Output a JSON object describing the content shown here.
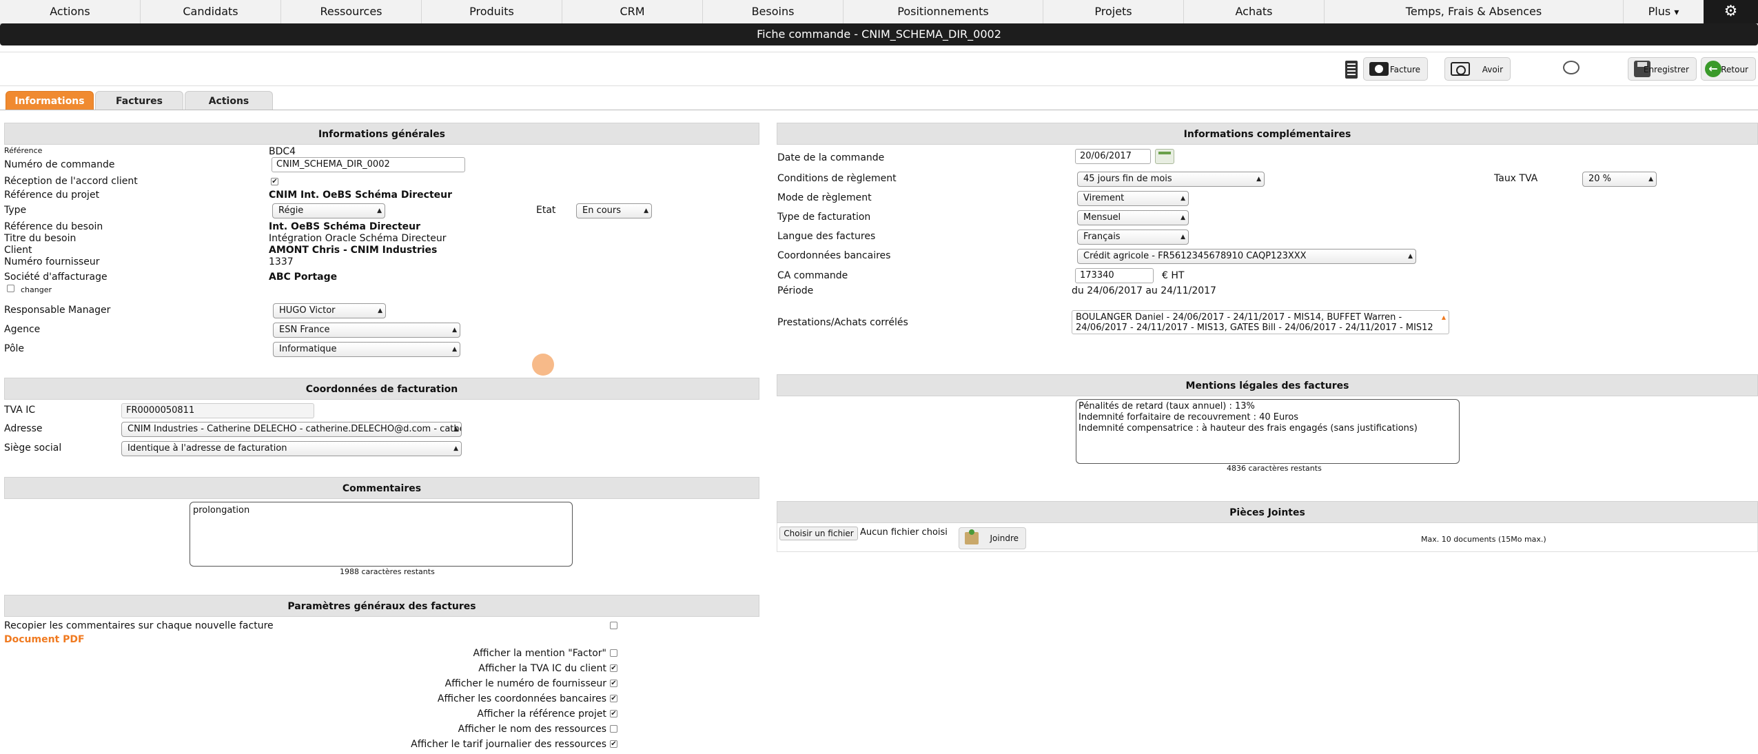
{
  "nav": {
    "items": [
      "Actions",
      "Candidats",
      "Ressources",
      "Produits",
      "CRM",
      "Besoins",
      "Positionnements",
      "Projets",
      "Achats",
      "Temps, Frais & Absences",
      "Plus"
    ],
    "plus_caret": "▾",
    "gear_icon": "⚙"
  },
  "title": "Fiche commande - CNIM_SCHEMA_DIR_0002",
  "toolbar": {
    "facture_label": "Facture",
    "avoir_label": "Avoir",
    "enregistrer_label": "Enregistrer",
    "retour_label": "Retour"
  },
  "tabs": [
    "Informations",
    "Factures",
    "Actions"
  ],
  "general": {
    "header": "Informations générales",
    "reference_label": "Référence",
    "reference_value": "BDC4",
    "numero_label": "Numéro de commande",
    "numero_value": "CNIM_SCHEMA_DIR_0002",
    "reception_label": "Réception de l'accord client",
    "reception_checked": "✔",
    "ref_projet_label": "Référence du projet",
    "ref_projet_value": "CNIM Int. OeBS Schéma Directeur",
    "type_label": "Type",
    "type_value": "Régie",
    "etat_label": "Etat",
    "etat_value": "En cours",
    "ref_besoin_label": "Référence du besoin",
    "ref_besoin_value": "Int. OeBS Schéma Directeur",
    "titre_besoin_label": "Titre du besoin",
    "titre_besoin_value": "Intégration Oracle Schéma Directeur",
    "client_label": "Client",
    "client_value": "AMONT Chris - CNIM Industries",
    "num_fourn_label": "Numéro fournisseur",
    "num_fourn_value": "1337",
    "affacturage_label": "Société d'affacturage",
    "affacturage_value": "ABC Portage",
    "changer_label": "changer",
    "manager_label": "Responsable Manager",
    "manager_value": "HUGO Victor",
    "agence_label": "Agence",
    "agence_value": "ESN France",
    "pole_label": "Pôle",
    "pole_value": "Informatique"
  },
  "billing": {
    "header": "Coordonnées de facturation",
    "tva_label": "TVA IC",
    "tva_value": "FR0000050811",
    "adresse_label": "Adresse",
    "adresse_value": "CNIM Industries - Catherine DELECHO - catherine.DELECHO@d.com - catherine",
    "siege_label": "Siège social",
    "siege_value": "Identique à l'adresse de facturation"
  },
  "comments": {
    "header": "Commentaires",
    "value": "prolongation",
    "remaining": "1988 caractères restants"
  },
  "params": {
    "header": "Paramètres généraux des factures",
    "recopier_label": "Recopier les commentaires sur chaque nouvelle facture",
    "pdf_label": "Document PDF",
    "options": [
      {
        "label": "Afficher la mention \"Factor\"",
        "mark": ""
      },
      {
        "label": "Afficher la TVA IC du client",
        "mark": "✔"
      },
      {
        "label": "Afficher le numéro de fournisseur",
        "mark": "✔"
      },
      {
        "label": "Afficher les coordonnées bancaires",
        "mark": "✔"
      },
      {
        "label": "Afficher la référence projet",
        "mark": "✔"
      },
      {
        "label": "Afficher le nom des ressources",
        "mark": ""
      },
      {
        "label": "Afficher le tarif journalier des ressources",
        "mark": "✔"
      }
    ]
  },
  "complement": {
    "header": "Informations complémentaires",
    "date_label": "Date de la commande",
    "date_value": "20/06/2017",
    "conditions_label": "Conditions de règlement",
    "conditions_value": "45 jours fin de mois",
    "tva_label": "Taux TVA",
    "tva_value": "20 %",
    "mode_label": "Mode de règlement",
    "mode_value": "Virement",
    "type_fact_label": "Type de facturation",
    "type_fact_value": "Mensuel",
    "langue_label": "Langue des factures",
    "langue_value": "Français",
    "coord_label": "Coordonnées bancaires",
    "coord_value": "Crédit agricole - FR5612345678910 CAQP123XXX",
    "ca_label": "CA commande",
    "ca_value": "173340",
    "ca_unit": "€ HT",
    "periode_label": "Période",
    "periode_value": "du 24/06/2017 au 24/11/2017",
    "prestations_label": "Prestations/Achats corrélés",
    "prestations_value": "BOULANGER Daniel - 24/06/2017 - 24/11/2017 - MIS14, BUFFET Warren - 24/06/2017 - 24/11/2017 - MIS13, GATES Bill - 24/06/2017 - 24/11/2017 - MIS12"
  },
  "mentions": {
    "header": "Mentions légales des factures",
    "value": "Pénalités de retard (taux annuel) : 13%\nIndemnité forfaitaire de recouvrement : 40 Euros\nIndemnité compensatrice : à hauteur des frais engagés (sans justifications)",
    "remaining": "4836 caractères restants"
  },
  "attachments": {
    "header": "Pièces Jointes",
    "choose_label": "Choisir un fichier",
    "no_file": "Aucun fichier choisi",
    "joindre_label": "Joindre",
    "max_label": "Max. 10 documents (15Mo max.)"
  }
}
